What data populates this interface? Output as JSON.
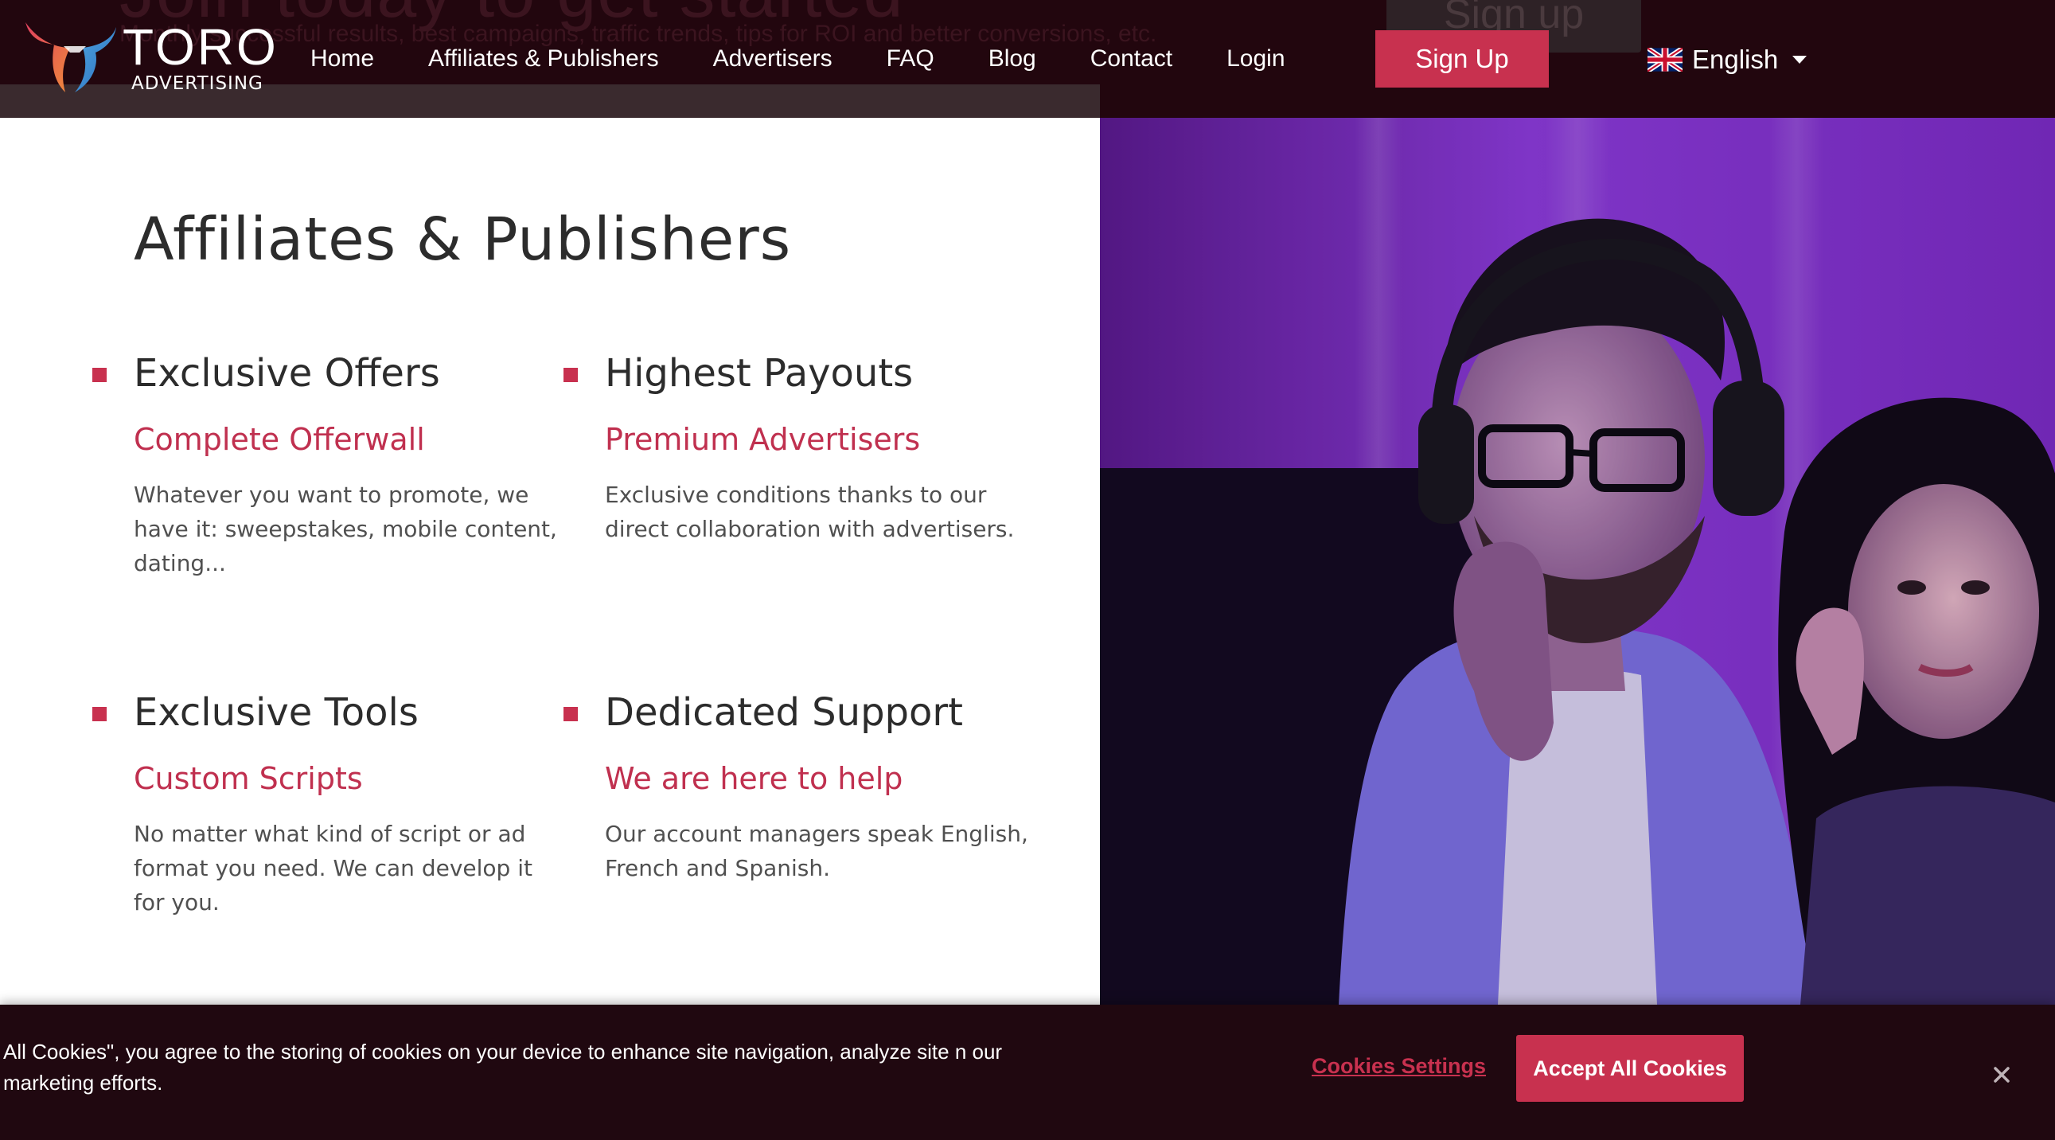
{
  "background_overlay": {
    "ghost_heading": "Join today to get started",
    "ghost_subtext": "Monthly successful results, best campaigns, traffic trends, tips for ROI and better conversions, etc.",
    "ghost_button": "Sign up"
  },
  "header": {
    "logo": {
      "wordmark": "TORO",
      "subtitle": "ADVERTISING",
      "icon": "toro-bull-logo-icon"
    },
    "nav": [
      {
        "label": "Home"
      },
      {
        "label": "Affiliates & Publishers"
      },
      {
        "label": "Advertisers"
      },
      {
        "label": "FAQ"
      },
      {
        "label": "Blog"
      },
      {
        "label": "Contact"
      },
      {
        "label": "Login"
      }
    ],
    "signup_label": "Sign Up",
    "language": {
      "label": "English",
      "flag_icon": "uk-flag-icon"
    }
  },
  "main": {
    "title": "Affiliates & Publishers",
    "features": [
      {
        "title": "Exclusive Offers",
        "subtitle": "Complete Offerwall",
        "description": "Whatever you want to promote, we have it: sweepstakes, mobile content, dating..."
      },
      {
        "title": "Highest Payouts",
        "subtitle": "Premium Advertisers",
        "description": "Exclusive conditions thanks to our direct collaboration with advertisers."
      },
      {
        "title": "Exclusive Tools",
        "subtitle": "Custom Scripts",
        "description": "No matter what kind of script or ad format you need. We can develop it for you."
      },
      {
        "title": "Dedicated Support",
        "subtitle": "We are here to help",
        "description": "Our account managers speak English, French and Spanish."
      }
    ]
  },
  "cookie_banner": {
    "text": "All Cookies\", you agree to the storing of cookies on your device to enhance site navigation, analyze site n our marketing efforts.",
    "settings_label": "Cookies Settings",
    "accept_label": "Accept All Cookies",
    "close_icon": "close-icon"
  },
  "colors": {
    "accent": "#c8314f",
    "header_bg": "#22060e",
    "banner_bg": "#200810",
    "heading_text": "#2c2c2c",
    "body_text": "#505050"
  }
}
